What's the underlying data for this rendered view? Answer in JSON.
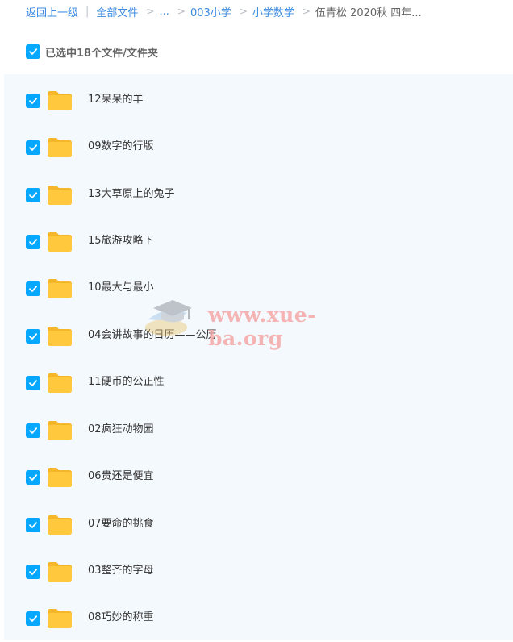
{
  "breadcrumb": {
    "back": "返回上一级",
    "all_files": "全部文件",
    "ellipsis": "...",
    "level1": "003小学",
    "level2": "小学数学",
    "current": "伍青松 2020秋 四年..."
  },
  "selection": {
    "label": "已选中18个文件/文件夹"
  },
  "files": [
    {
      "name": "12呆呆的羊"
    },
    {
      "name": "09数字的行版"
    },
    {
      "name": "13大草原上的兔子"
    },
    {
      "name": "15旅游攻略下"
    },
    {
      "name": "10最大与最小"
    },
    {
      "name": "04会讲故事的日历——公历"
    },
    {
      "name": "11硬币的公正性"
    },
    {
      "name": "02疯狂动物园"
    },
    {
      "name": "06贵还是便宜"
    },
    {
      "name": "07要命的挑食"
    },
    {
      "name": "03整齐的字母"
    },
    {
      "name": "08巧妙的称重"
    }
  ],
  "watermark": {
    "text": "www.xue-ba.org"
  },
  "colors": {
    "accent": "#06a7ff",
    "link": "#3d8be0",
    "list_bg": "#f4f9fd",
    "folder": "#ffc53d"
  },
  "icons": {
    "checkbox": "checkbox-checked-icon",
    "folder": "folder-icon",
    "chevron": "chevron-right-icon"
  }
}
